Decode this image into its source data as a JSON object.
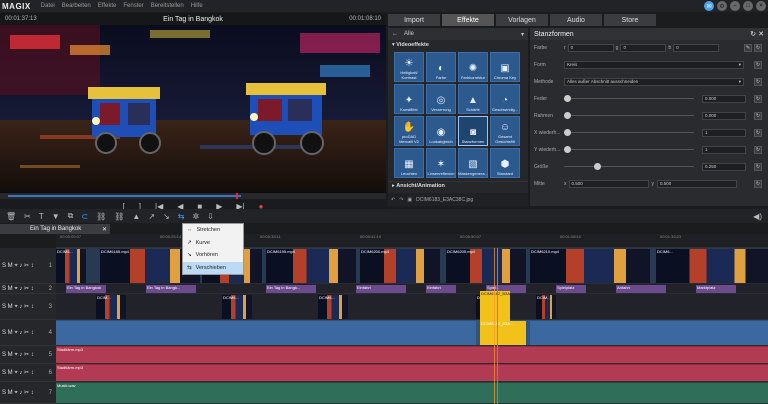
{
  "app": {
    "logo": "MAGIX",
    "menu": [
      "Datei",
      "Bearbeiten",
      "Effekte",
      "Fenster",
      "Bereitstellen",
      "Hilfe"
    ]
  },
  "preview": {
    "tc_left": "00:01:37:13",
    "title": "Ein Tag in Bangkok",
    "tc_right": "00:01:08:10",
    "scrub_label": "00:08:10",
    "progress": 0.63
  },
  "tabs": [
    "Import",
    "Effekte",
    "Vorlagen",
    "Audio",
    "Store"
  ],
  "active_tab": "Effekte",
  "effects": {
    "filter": "Alle",
    "category": "Videoeffekte",
    "items": [
      {
        "label": "Helligkeit/\nKontrast",
        "icon": "☀"
      },
      {
        "label": "Farbe",
        "icon": "◐"
      },
      {
        "label": "Farbkorrektur",
        "icon": "✺"
      },
      {
        "label": "Chroma Key",
        "icon": "▣"
      },
      {
        "label": "Kunstfilter",
        "icon": "✦"
      },
      {
        "label": "Verzerrung",
        "icon": "◎"
      },
      {
        "label": "Schärfe",
        "icon": "▲"
      },
      {
        "label": "Geschwindig...",
        "icon": "◔"
      },
      {
        "label": "proDAD\nMercalli V2",
        "icon": "✋"
      },
      {
        "label": "Lookabgleich",
        "icon": "◉"
      },
      {
        "label": "Stanzformen",
        "icon": "◙"
      },
      {
        "label": "Gesamt Gesichtsfilt",
        "icon": "☺"
      },
      {
        "label": "Leuchten",
        "icon": "▦"
      },
      {
        "label": "Linsenreflexion",
        "icon": "✶"
      },
      {
        "label": "Maskengenera...",
        "icon": "▧"
      },
      {
        "label": "Standard",
        "icon": "⬢"
      }
    ],
    "selected_index": 10,
    "section2": "Ansicht/Animation",
    "file": "DCIM6183_E3AC38C.jpg"
  },
  "props": {
    "title": "Stanzformen",
    "rows": [
      {
        "name": "Farbe",
        "extra": "",
        "v1": "0",
        "v2": "0",
        "v3": "0"
      },
      {
        "name": "Form",
        "value": "Kreis"
      },
      {
        "name": "Methode",
        "value": "Alles außer Abschnitt ausschneiden"
      },
      {
        "name": "Feder",
        "value": "0.000"
      },
      {
        "name": "Rahmen",
        "value": "0.000"
      },
      {
        "name": "X wiederh...",
        "value": "1"
      },
      {
        "name": "Y wiederh...",
        "value": "1"
      },
      {
        "name": "Größe",
        "value": "0.250"
      },
      {
        "name": "Mitte",
        "x": "0.500",
        "y": "0.500"
      }
    ]
  },
  "context_menu": {
    "items": [
      "Stretchen",
      "Kurve",
      "Vorhören",
      "Verschieben"
    ],
    "selected": 3
  },
  "project_tab": "Ein Tag in Bangkok",
  "ruler": [
    "00:00:09:07",
    "00:00:25:14",
    "00:00:33:11",
    "00:00:41:19",
    "00:00:50:07",
    "00:01:08:10",
    "00:01:33:23"
  ],
  "tracks": [
    {
      "label": "S M ⌖ ♪ ✂ ↕",
      "num": "1"
    },
    {
      "label": "S M ⌖ ♪ ✂ ↕",
      "num": "2"
    },
    {
      "label": "S M ⌖ ♪ ✂ ↕",
      "num": "3"
    },
    {
      "label": "S M ⌖ ♪ ✂ ↕",
      "num": "4"
    },
    {
      "label": "S M ⌖ ♪ ✂ ↕",
      "num": "5"
    },
    {
      "label": "S M ⌖ ♪ ✂ ↕",
      "num": "6"
    },
    {
      "label": "S M ⌖ ♪ ✂ ↕",
      "num": "7"
    }
  ],
  "clip_labels": {
    "t1": [
      "DCIM6...",
      "DCIM6185.mp4",
      "DCIM6190.mp4",
      "DCIM6195.mp4",
      "DCIM6200.mp4",
      "DCIM6205.mp4",
      "DCIM6210.mp4"
    ],
    "t2": [
      "Ein Tag in Bangkok",
      "Ein Tag in Bangk...",
      "Ein Tag in Bangk...",
      "Einfahrt",
      "Einfahrt",
      "Spiel...",
      "Spielplatz",
      "Anfahrt",
      "Marktplatz"
    ],
    "t3": [
      "DCIM...",
      "DCIM6...",
      "DCIM6...",
      "DCIM6182_B3AC38C..."
    ],
    "t4": [
      "DCIM6182_B3A..."
    ],
    "t5": [
      "Stadtlärm.mp3"
    ],
    "t6": [
      "Stadtlärm.mp3"
    ],
    "t7": [
      "Musik.wav"
    ]
  },
  "colors": {
    "accent": "#3a76c4",
    "clip_video": "#4a6fa8",
    "clip_title": "#6b4a8e",
    "clip_audio": "#b23a52",
    "clip_music": "#2f6f5a",
    "selected": "#f2c21b"
  }
}
